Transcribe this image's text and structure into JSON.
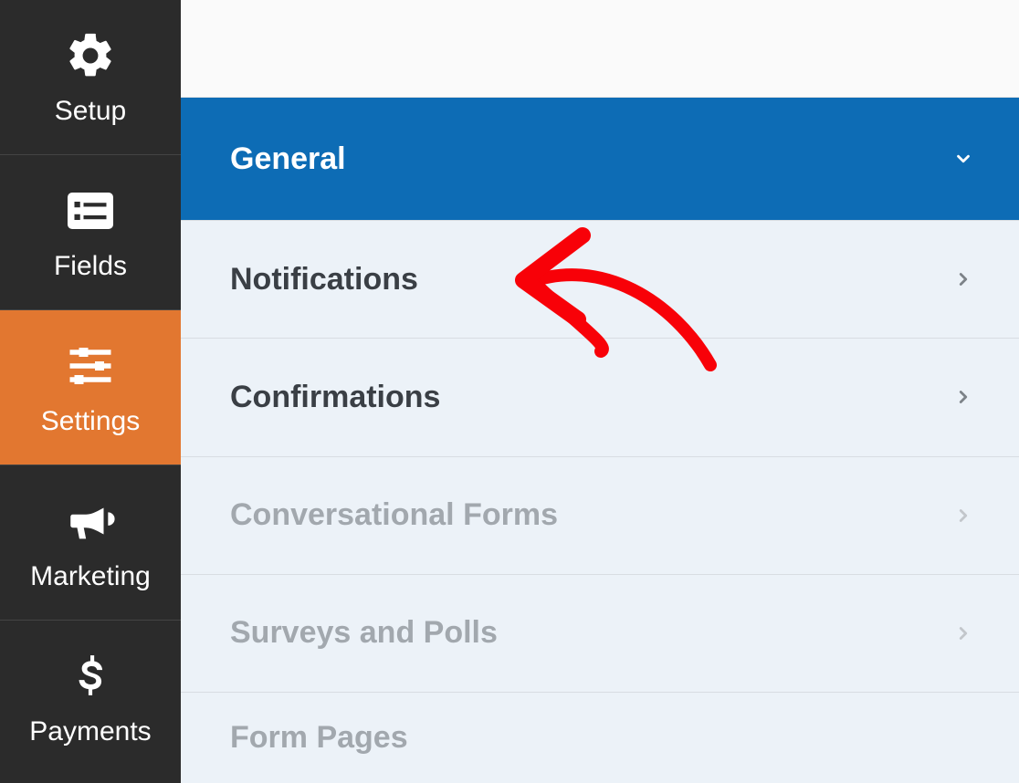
{
  "sidebar": {
    "items": [
      {
        "id": "setup",
        "label": "Setup",
        "icon": "gear-icon",
        "active": false
      },
      {
        "id": "fields",
        "label": "Fields",
        "icon": "list-icon",
        "active": false
      },
      {
        "id": "settings",
        "label": "Settings",
        "icon": "sliders-icon",
        "active": true
      },
      {
        "id": "marketing",
        "label": "Marketing",
        "icon": "bullhorn-icon",
        "active": false
      },
      {
        "id": "payments",
        "label": "Payments",
        "icon": "dollar-icon",
        "active": false
      }
    ]
  },
  "settings_panel": {
    "items": [
      {
        "id": "general",
        "label": "General",
        "active": true,
        "disabled": false
      },
      {
        "id": "notifications",
        "label": "Notifications",
        "active": false,
        "disabled": false
      },
      {
        "id": "confirmations",
        "label": "Confirmations",
        "active": false,
        "disabled": false
      },
      {
        "id": "conversational_forms",
        "label": "Conversational Forms",
        "active": false,
        "disabled": true
      },
      {
        "id": "surveys_polls",
        "label": "Surveys and Polls",
        "active": false,
        "disabled": true
      },
      {
        "id": "form_pages",
        "label": "Form Pages",
        "active": false,
        "disabled": true
      }
    ]
  },
  "colors": {
    "sidebar_bg": "#2b2b2b",
    "sidebar_active": "#e27730",
    "panel_active": "#0d6cb5",
    "panel_bg": "#ecf2f8",
    "annotation": "#f80108"
  }
}
